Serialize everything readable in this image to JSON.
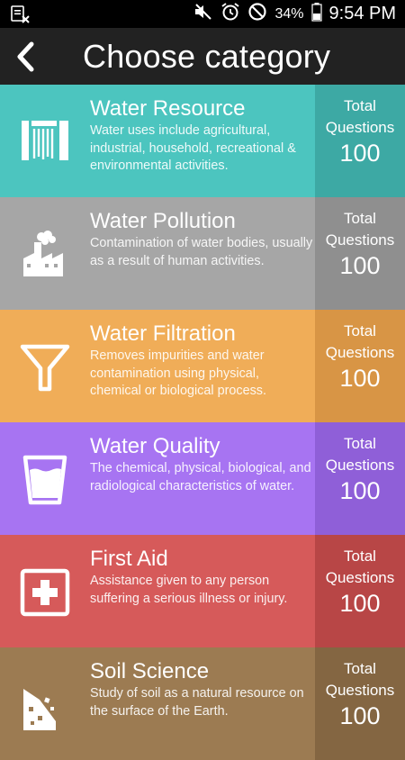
{
  "status_bar": {
    "battery_percent": "34%",
    "time": "9:54 PM",
    "icons": [
      "notification-app-icon",
      "mute-icon",
      "alarm-icon",
      "do-not-disturb-icon",
      "battery-icon"
    ]
  },
  "header": {
    "title": "Choose category",
    "back_icon": "back-arrow-icon",
    "background": "#222222"
  },
  "categories": [
    {
      "name": "Water Resource",
      "description": "Water uses include agricultural, industrial, household, recreational & environmental activities.",
      "stat_label": "Total Questions",
      "count": "100",
      "icon": "waterfall-icon",
      "color": "#4cc5bf",
      "stat_color": "#3da9a4"
    },
    {
      "name": "Water Pollution",
      "description": "Contamination of water bodies, usually as a result of human activities.",
      "stat_label": "Total Questions",
      "count": "100",
      "icon": "factory-icon",
      "color": "#a6a6a6",
      "stat_color": "#8f8f8f"
    },
    {
      "name": "Water Filtration",
      "description": "Removes impurities and water contamination using physical, chemical or biological process.",
      "stat_label": "Total Questions",
      "count": "100",
      "icon": "funnel-icon",
      "color": "#f0ad58",
      "stat_color": "#d89545"
    },
    {
      "name": "Water Quality",
      "description": "The chemical, physical, biological, and radiological characteristics of water.",
      "stat_label": "Total Questions",
      "count": "100",
      "icon": "water-glass-icon",
      "color": "#a774f2",
      "stat_color": "#8f5fd8"
    },
    {
      "name": "First Aid",
      "description": "Assistance given to any person suffering a serious illness or injury.",
      "stat_label": "Total Questions",
      "count": "100",
      "icon": "first-aid-icon",
      "color": "#d65a5a",
      "stat_color": "#b84646"
    },
    {
      "name": "Soil Science",
      "description": "Study of soil as a natural resource on the surface of the Earth.",
      "stat_label": "Total Questions",
      "count": "100",
      "icon": "soil-icon",
      "color": "#9c7b52",
      "stat_color": "#846642"
    }
  ]
}
